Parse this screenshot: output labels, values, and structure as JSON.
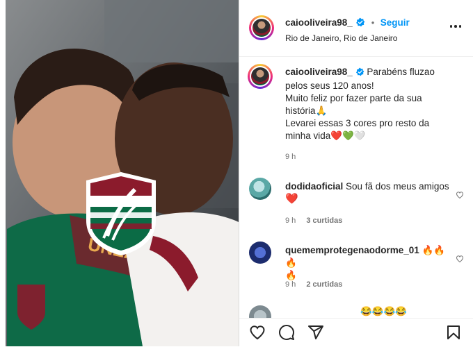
{
  "post": {
    "username": "caiooliveira98_",
    "follow_label": "Seguir",
    "separator": "•",
    "location": "Rio de Janeiro, Rio de Janeiro"
  },
  "caption": {
    "username": "caiooliveira98_",
    "text_line1": "Parabéns fluzao",
    "text_line2": "pelos seus 120 anos!",
    "text_line3": "Muito feliz por fazer parte da sua",
    "text_line4": "história🙏",
    "text_line5": "Levarei essas 3 cores pro resto da",
    "text_line6": "minha vida❤️💚🤍",
    "time": "9 h"
  },
  "comments": [
    {
      "username": "dodidaoficial",
      "text": "Sou fã dos meus amigos",
      "emoji": "❤️",
      "time": "9 h",
      "likes": "3 curtidas"
    },
    {
      "username": "quememprotegenaodorme_01",
      "text": "🔥🔥🔥",
      "emoji": "🔥",
      "time": "9 h",
      "likes": "2 curtidas"
    },
    {
      "username": "",
      "text": "😂😂😂😂"
    }
  ],
  "media": {
    "shirt_text": "UNZAPE",
    "colors": {
      "grena": "#8b1b2c",
      "green": "#0b6b45",
      "white": "#ffffff"
    }
  },
  "icons": [
    "heart-icon",
    "comment-icon",
    "share-icon",
    "bookmark-icon",
    "more-options-icon",
    "verified-icon"
  ]
}
